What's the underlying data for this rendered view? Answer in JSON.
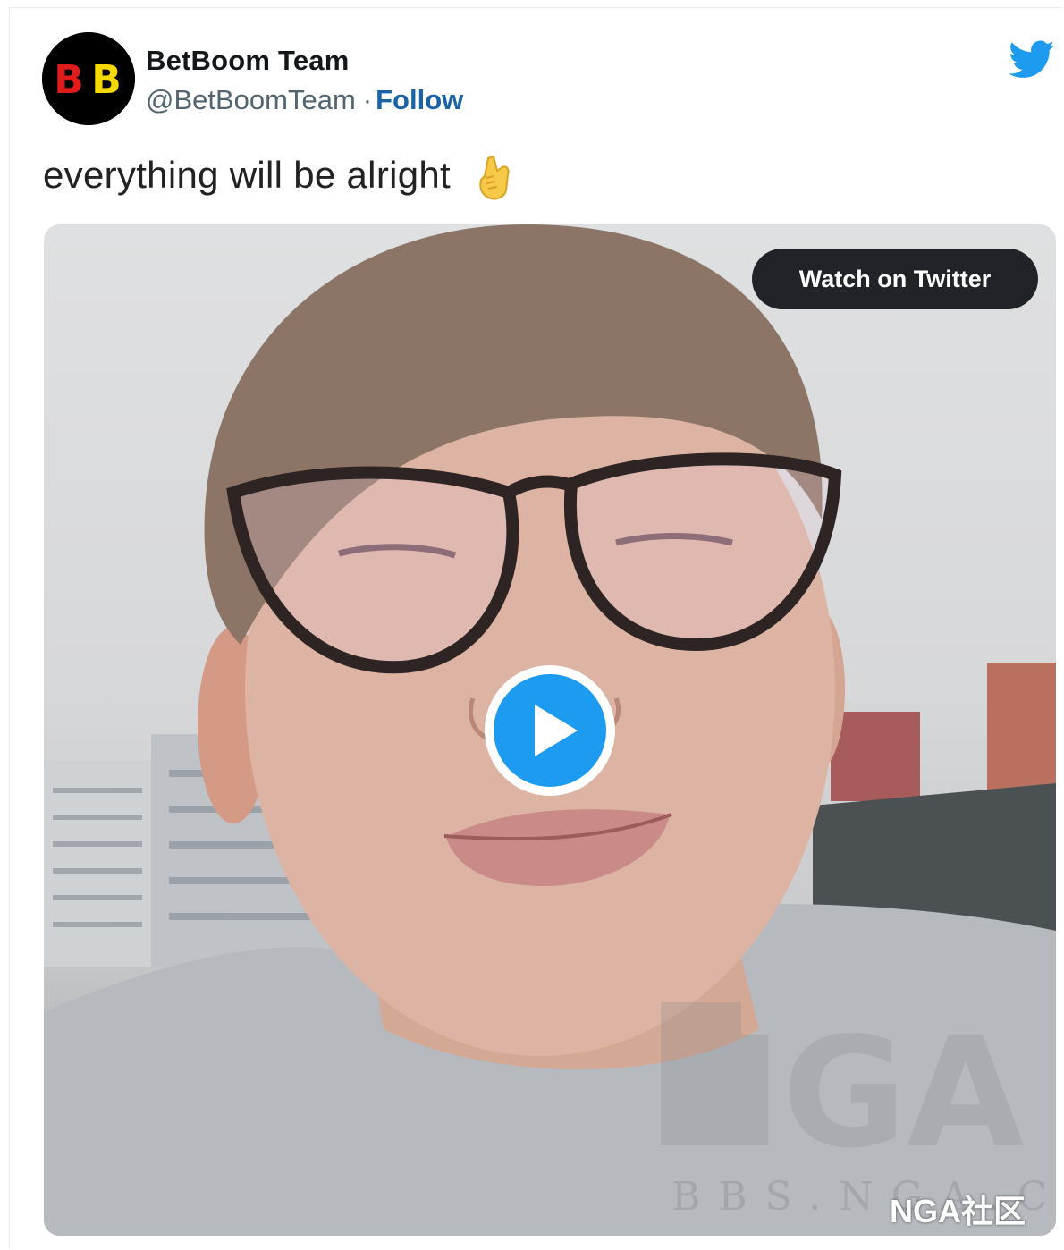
{
  "tweet": {
    "display_name": "BetBoom Team",
    "handle": "@BetBoomTeam",
    "separator": "·",
    "follow_label": "Follow",
    "avatar_text": "BB",
    "text": "everything will be alright",
    "emoji_icon": "hand-with-index-finger-and-thumb-crossed-icon",
    "platform_icon": "twitter-bird-icon"
  },
  "media": {
    "watch_label": "Watch on Twitter",
    "play_icon": "play-icon",
    "watermark_text": "BBS.NGA.CN",
    "watermark_logo_text": "NGA",
    "source_label": "NGA社区"
  },
  "colors": {
    "follow": "#1b63a8",
    "twitter_blue": "#1d9bf0",
    "watch_button_bg": "#202327",
    "avatar_red": "#e01b1b",
    "avatar_yellow": "#f5d800"
  }
}
